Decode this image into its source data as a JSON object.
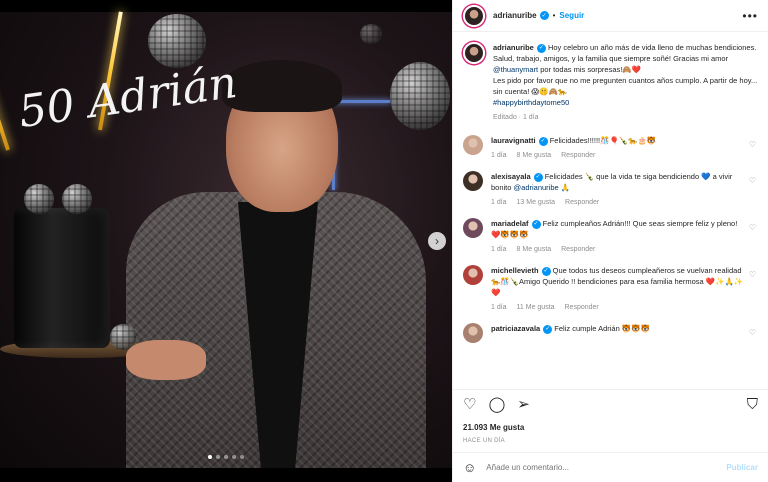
{
  "post": {
    "author": "adrianuribe",
    "follow_label": "Seguir",
    "separator": "•",
    "more_icon": "•••",
    "topper_text": "50 Adrián",
    "caption_html_parts": {
      "text1": "Hoy celebro un año más de vida lleno de muchas bendiciones. Salud, trabajo, amigos, y la familia que siempre soñé! Gracias mi amor ",
      "mention": "@thuanymart",
      "text2": " por todas mis sorpresas!🙈❤️",
      "text3": "Les pido por favor que no me pregunten cuantos años cumplo. A partir de hoy... sin cuenta! 😱🤫🙈🐆",
      "hashtag": "#happybirthdaytome50"
    },
    "caption_meta": "Editado · 1 día",
    "likes": "21.093 Me gusta",
    "time_ago": "HACE UN DÍA",
    "add_comment_placeholder": "Añade un comentario...",
    "publish_label": "Publicar"
  },
  "comments": [
    {
      "user": "lauravignatti",
      "text": "Felicidades!!!!!!🎊🎈🍾🐆🎂🐯",
      "time": "1 día",
      "likes": "8 Me gusta",
      "reply": "Responder",
      "color": "#c9a38e"
    },
    {
      "user": "alexisayala",
      "text": "Felicidades 🍾 que la vida te siga bendiciendo 💙 a vivir bonito ",
      "mention": "@adrianuribe",
      "tail": " 🙏",
      "time": "1 día",
      "likes": "13 Me gusta",
      "reply": "Responder",
      "color": "#3d2f26"
    },
    {
      "user": "mariadelaf",
      "text": "Feliz cumpleaños Adrián!!! Que seas siempre feliz y pleno! ❤️🐯🐯🐯",
      "time": "1 día",
      "likes": "8 Me gusta",
      "reply": "Responder",
      "color": "#6e4a5c"
    },
    {
      "user": "michellevieth",
      "text": "Que todos tus deseos cumpleañeros se vuelvan realidad 🐆🎊🍾Amigo Querido !! bendiciones para esa familia hermosa ❤️✨🙏✨❤️",
      "time": "1 día",
      "likes": "11 Me gusta",
      "reply": "Responder",
      "color": "#b0403a"
    },
    {
      "user": "patriciazavala",
      "text": "Feliz cumple Adrián 🐯🐯🐯",
      "time": "",
      "likes": "",
      "reply": "",
      "color": "#a88070"
    }
  ],
  "icons": {
    "heart": "♡",
    "comment": "◯",
    "share": "➢",
    "bookmark": "⛉",
    "emoji": "☺",
    "next": "›"
  }
}
